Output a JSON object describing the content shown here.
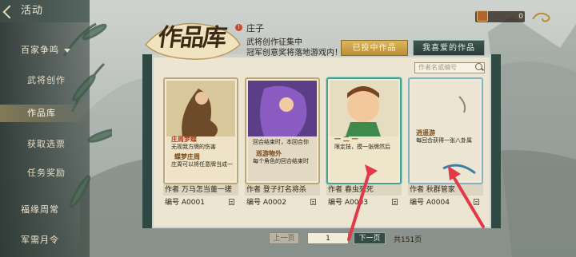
{
  "sidebar": {
    "header": "活动",
    "items": [
      {
        "label": "百家争鸣",
        "has_caret": true
      },
      {
        "label": "武将创作"
      },
      {
        "label": "作品库",
        "active": true
      },
      {
        "label": "获取选票"
      },
      {
        "label": "任务奖励"
      },
      {
        "label": "福缘周常"
      },
      {
        "label": "军需月令"
      }
    ]
  },
  "header": {
    "title": "作品库",
    "badge": "!",
    "person": "庄子",
    "notice_line1": "武将创作征集中",
    "notice_line2": "冠军创意奖将落地游戏内！",
    "tabs": [
      {
        "label": "已投中作品",
        "selected": true
      },
      {
        "label": "我喜爱的作品",
        "selected": false
      }
    ]
  },
  "currency": {
    "value": "0",
    "icon": "treasure-chest-icon"
  },
  "search": {
    "placeholder": "作者名或编号"
  },
  "cards": [
    {
      "name1": "庄周梦蝶",
      "desc1": "无视我方牌的伤害",
      "name2": "蝶梦庄周",
      "desc2": "庄周可以将任意牌当成一",
      "author_label": "作者",
      "author": "万马怎当董一搓",
      "num_label": "编号",
      "num": "A0001"
    },
    {
      "name1": "",
      "desc1": "回合结束时，本回合你",
      "name2": "巡游物外",
      "desc2": "每个角色的回合结束时",
      "author_label": "作者",
      "author": "登子打名将杀",
      "num_label": "编号",
      "num": "A0002"
    },
    {
      "name1": "一 二 一",
      "desc1": "限定技，摸一张牌然后",
      "name2": "",
      "desc2": "",
      "author_label": "作者",
      "author": "春虫死死",
      "num_label": "编号",
      "num": "A0003"
    },
    {
      "name1": "逍遥游",
      "desc1": "每回合获得一张八卦属",
      "name2": "",
      "desc2": "",
      "author_label": "作者",
      "author": "秋群管家",
      "num_label": "编号",
      "num": "A0004"
    }
  ],
  "pager": {
    "prev": "上一页",
    "current": "1",
    "next": "下一页",
    "total": "共151页"
  }
}
